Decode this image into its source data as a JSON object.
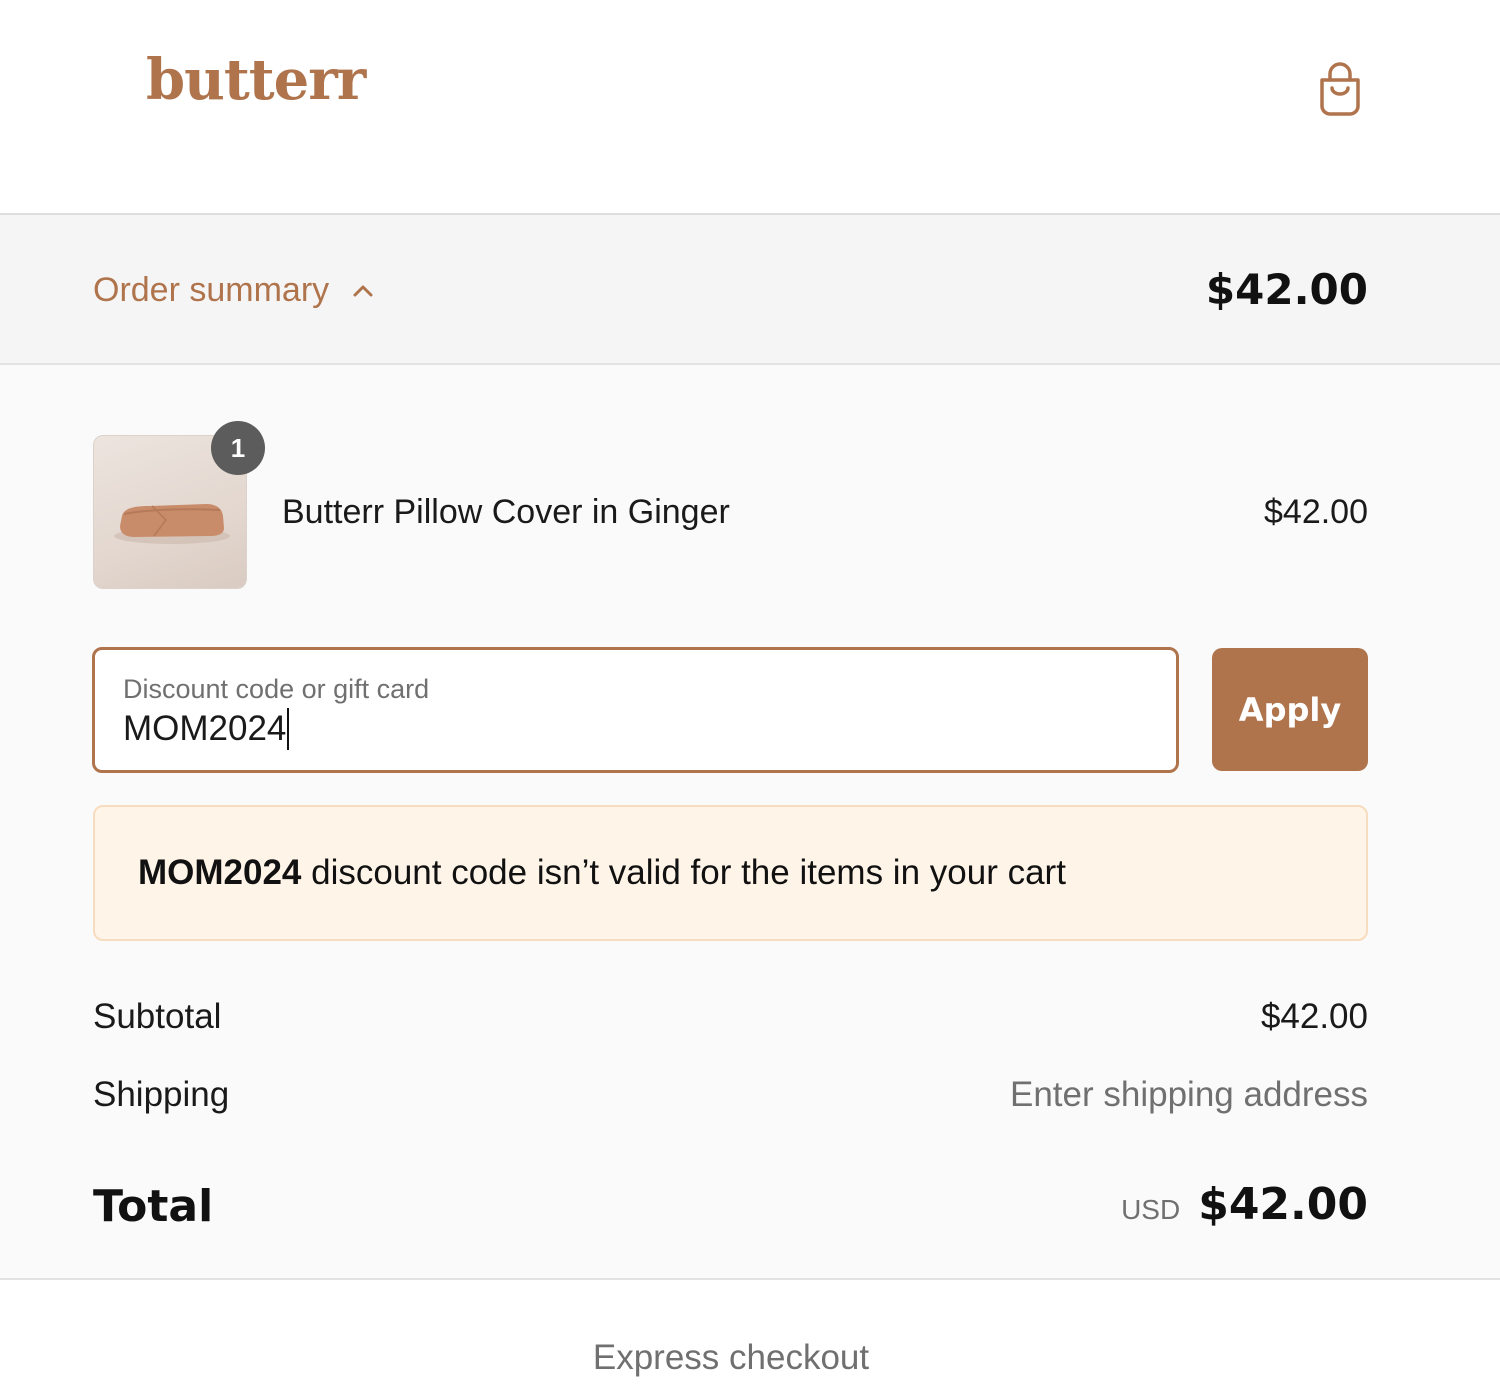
{
  "header": {
    "logo_text": "butterr",
    "cart_icon": "shopping-bag-icon"
  },
  "summary": {
    "toggle_label": "Order summary",
    "toggle_icon": "chevron-up-icon",
    "total": "$42.00"
  },
  "cart": {
    "items": [
      {
        "name": "Butterr Pillow Cover in Ginger",
        "price": "$42.00",
        "quantity": "1"
      }
    ]
  },
  "discount": {
    "placeholder": "Discount code or gift card",
    "value": "MOM2024",
    "apply_label": "Apply"
  },
  "alert": {
    "code": "MOM2024",
    "message": " discount code isn’t valid for the items in your cart"
  },
  "totals": {
    "subtotal_label": "Subtotal",
    "subtotal_value": "$42.00",
    "shipping_label": "Shipping",
    "shipping_value": "Enter shipping address",
    "total_label": "Total",
    "currency": "USD",
    "total_value": "$42.00"
  },
  "express": {
    "label": "Express checkout"
  },
  "colors": {
    "brand": "#b0744d",
    "alert_bg": "#fff4e8",
    "alert_border": "#f7dcc0",
    "summary_bg": "#f5f5f5"
  }
}
